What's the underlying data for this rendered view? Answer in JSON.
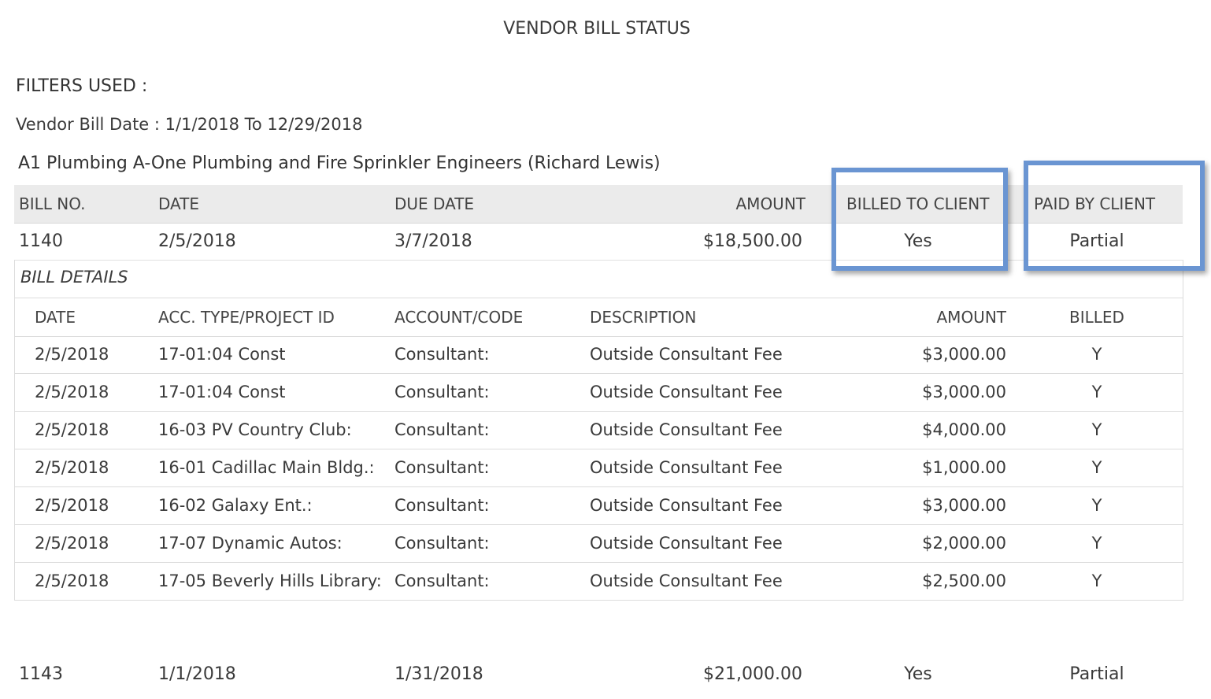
{
  "report": {
    "title": "VENDOR BILL STATUS",
    "filters_heading": "FILTERS USED :",
    "filter_line": "Vendor Bill Date : 1/1/2018 To 12/29/2018"
  },
  "vendor": {
    "name": "A1 Plumbing A-One Plumbing and Fire Sprinkler Engineers (Richard Lewis)"
  },
  "bill_table": {
    "headers": {
      "bill_no": "BILL NO.",
      "date": "DATE",
      "due_date": "DUE DATE",
      "amount": "AMOUNT",
      "billed_to_client": "BILLED TO CLIENT",
      "paid_by_client": "PAID BY CLIENT"
    },
    "row": {
      "bill_no": "1140",
      "date": "2/5/2018",
      "due_date": "3/7/2018",
      "amount": "$18,500.00",
      "billed_to_client": "Yes",
      "paid_by_client": "Partial"
    }
  },
  "bill_details": {
    "label": "BILL DETAILS",
    "headers": {
      "date": "DATE",
      "acc_type": "ACC. TYPE/PROJECT ID",
      "account": "ACCOUNT/CODE",
      "description": "DESCRIPTION",
      "amount": "AMOUNT",
      "billed": "BILLED"
    },
    "rows": [
      {
        "date": "2/5/2018",
        "acc_type": "17-01:04 Const",
        "account": "Consultant:",
        "description": "Outside Consultant Fee",
        "amount": "$3,000.00",
        "billed": "Y"
      },
      {
        "date": "2/5/2018",
        "acc_type": "17-01:04 Const",
        "account": "Consultant:",
        "description": "Outside Consultant Fee",
        "amount": "$3,000.00",
        "billed": "Y"
      },
      {
        "date": "2/5/2018",
        "acc_type": "16-03 PV Country Club:",
        "account": "Consultant:",
        "description": "Outside Consultant Fee",
        "amount": "$4,000.00",
        "billed": "Y"
      },
      {
        "date": "2/5/2018",
        "acc_type": "16-01 Cadillac Main Bldg.:",
        "account": "Consultant:",
        "description": "Outside Consultant Fee",
        "amount": "$1,000.00",
        "billed": "Y"
      },
      {
        "date": "2/5/2018",
        "acc_type": "16-02 Galaxy Ent.:",
        "account": "Consultant:",
        "description": "Outside Consultant Fee",
        "amount": "$3,000.00",
        "billed": "Y"
      },
      {
        "date": "2/5/2018",
        "acc_type": "17-07 Dynamic Autos:",
        "account": "Consultant:",
        "description": "Outside Consultant Fee",
        "amount": "$2,000.00",
        "billed": "Y"
      },
      {
        "date": "2/5/2018",
        "acc_type": "17-05 Beverly Hills Library:",
        "account": "Consultant:",
        "description": "Outside Consultant Fee",
        "amount": "$2,500.00",
        "billed": "Y"
      }
    ]
  },
  "next_bill_row": {
    "bill_no": "1143",
    "date": "1/1/2018",
    "due_date": "1/31/2018",
    "amount": "$21,000.00",
    "billed_to_client": "Yes",
    "paid_by_client": "Partial"
  },
  "highlight_color": "#6a95d2"
}
